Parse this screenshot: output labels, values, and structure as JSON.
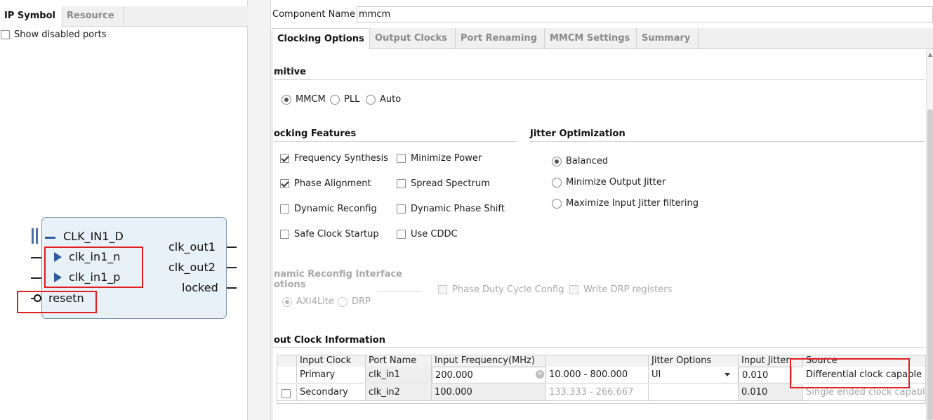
{
  "left_panel": {
    "tabs": [
      {
        "label": "IP Symbol",
        "active": true
      },
      {
        "label": "Resource",
        "active": false
      }
    ],
    "show_disabled_ports": {
      "label": "Show disabled ports",
      "checked": false
    }
  },
  "ip_symbol": {
    "bus_label": "CLK_IN1_D",
    "inputs": [
      {
        "label": "clk_in1_n"
      },
      {
        "label": "clk_in1_p"
      }
    ],
    "reset_label": "resetn",
    "outputs": [
      {
        "label": "clk_out1"
      },
      {
        "label": "clk_out2"
      },
      {
        "label": "locked"
      }
    ]
  },
  "component": {
    "label": "Component Name",
    "value": "mmcm"
  },
  "tabs": [
    {
      "label": "Clocking Options",
      "active": true
    },
    {
      "label": "Output Clocks",
      "active": false
    },
    {
      "label": "Port Renaming",
      "active": false
    },
    {
      "label": "MMCM Settings",
      "active": false
    },
    {
      "label": "Summary",
      "active": false
    }
  ],
  "primitive": {
    "title": "mitive",
    "options": [
      {
        "label": "MMCM",
        "selected": true
      },
      {
        "label": "PLL",
        "selected": false
      },
      {
        "label": "Auto",
        "selected": false
      }
    ]
  },
  "clocking_features": {
    "title": "ocking Features",
    "items": [
      {
        "label": "Frequency Synthesis",
        "checked": true
      },
      {
        "label": "Minimize Power",
        "checked": false
      },
      {
        "label": "Phase Alignment",
        "checked": true
      },
      {
        "label": "Spread Spectrum",
        "checked": false
      },
      {
        "label": "Dynamic Reconfig",
        "checked": false
      },
      {
        "label": "Dynamic Phase Shift",
        "checked": false
      },
      {
        "label": "Safe Clock Startup",
        "checked": false
      },
      {
        "label": "Use CDDC",
        "checked": false
      }
    ]
  },
  "jitter_optimization": {
    "title": "Jitter Optimization",
    "options": [
      {
        "label": "Balanced",
        "selected": true
      },
      {
        "label": "Minimize Output Jitter",
        "selected": false
      },
      {
        "label": "Maximize Input Jitter filtering",
        "selected": false
      }
    ]
  },
  "dynamic_reconfig": {
    "title_line1": "namic Reconfig Interface",
    "title_line2": "otions",
    "options": [
      {
        "label": "AXI4Lite",
        "selected": true
      },
      {
        "label": "DRP",
        "selected": false
      }
    ],
    "phase_duty": {
      "label": "Phase Duty Cycle Config",
      "checked": false
    },
    "write_drp": {
      "label": "Write DRP registers",
      "checked": false
    }
  },
  "input_clock_info": {
    "title": "out Clock Information",
    "headers": [
      "Input Clock",
      "Port Name",
      "Input Frequency(MHz)",
      "",
      "Jitter Options",
      "Input Jitter",
      "Source"
    ],
    "rows": [
      {
        "checkbox": false,
        "input_clock": "Primary",
        "port_name": "clk_in1",
        "frequency": "200.000",
        "range": "10.000 - 800.000",
        "jitter_option": "UI",
        "input_jitter": "0.010",
        "source": "Differential clock capable p"
      },
      {
        "checkbox": false,
        "input_clock": "Secondary",
        "port_name": "clk_in2",
        "frequency": "100.000",
        "range": "133.333 - 266.667",
        "jitter_option": "",
        "input_jitter": "0.010",
        "source": "Single ended clock capabl."
      }
    ]
  },
  "colors": {
    "highlight": "#e02020",
    "ip_block_fill": "#e8f0f8",
    "ip_block_border": "#7c93b3",
    "port_arrow": "#2f5aa0"
  }
}
